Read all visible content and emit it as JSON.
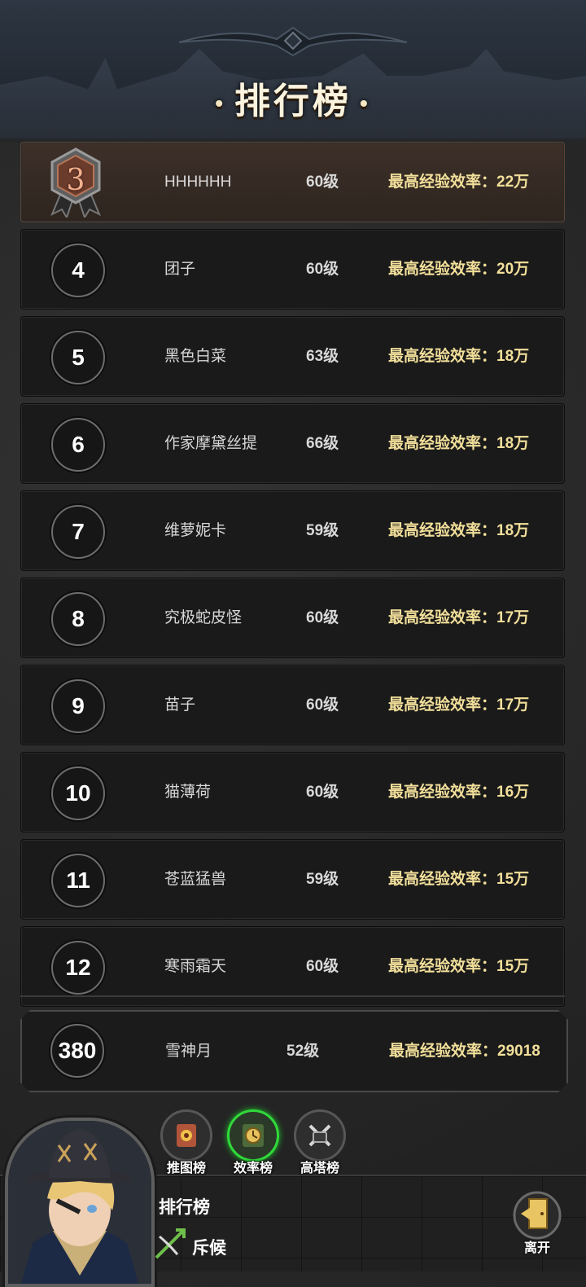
{
  "header": {
    "title": "排行榜",
    "dot": "•"
  },
  "rows": [
    {
      "rank": "3",
      "name": "HHHHHH",
      "level": "60级",
      "efficiency": "最高经验效率：22万"
    },
    {
      "rank": "4",
      "name": "团子",
      "level": "60级",
      "efficiency": "最高经验效率：20万"
    },
    {
      "rank": "5",
      "name": "黑色白菜",
      "level": "63级",
      "efficiency": "最高经验效率：18万"
    },
    {
      "rank": "6",
      "name": "作家摩黛丝提",
      "level": "66级",
      "efficiency": "最高经验效率：18万"
    },
    {
      "rank": "7",
      "name": "维萝妮卡",
      "level": "59级",
      "efficiency": "最高经验效率：18万"
    },
    {
      "rank": "8",
      "name": "究极蛇皮怪",
      "level": "60级",
      "efficiency": "最高经验效率：17万"
    },
    {
      "rank": "9",
      "name": "苗子",
      "level": "60级",
      "efficiency": "最高经验效率：17万"
    },
    {
      "rank": "10",
      "name": "猫薄荷",
      "level": "60级",
      "efficiency": "最高经验效率：16万"
    },
    {
      "rank": "11",
      "name": "苍蓝猛兽",
      "level": "59级",
      "efficiency": "最高经验效率：15万"
    },
    {
      "rank": "12",
      "name": "寒雨霜天",
      "level": "60级",
      "efficiency": "最高经验效率：15万"
    }
  ],
  "self": {
    "rank": "380",
    "name": "雪神月",
    "level": "52级",
    "efficiency": "最高经验效率：29018"
  },
  "tabs": [
    {
      "label": "推图榜",
      "icon": "map-ranking-icon",
      "active": false
    },
    {
      "label": "效率榜",
      "icon": "clock-ranking-icon",
      "active": true
    },
    {
      "label": "高塔榜",
      "icon": "tower-ranking-icon",
      "active": false
    }
  ],
  "bottom": {
    "title": "排行榜",
    "job_label": "斥候",
    "job_icon": "crossbow-icon",
    "exit_label": "离开",
    "exit_icon": "exit-door-icon"
  },
  "colors": {
    "efficiency": "#f2df9a",
    "active_tab": "#2fd93a",
    "medal_bronze": "#f3b08e"
  }
}
